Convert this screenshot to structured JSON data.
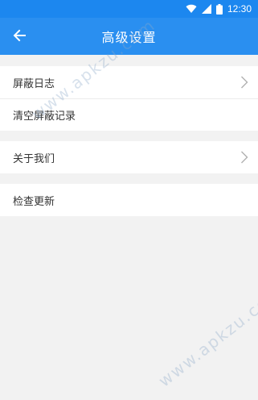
{
  "status_bar": {
    "time": "12:30"
  },
  "app_bar": {
    "title": "高级设置"
  },
  "groups": [
    {
      "items": [
        {
          "label": "屏蔽日志",
          "has_chevron": true
        },
        {
          "label": "清空屏蔽记录",
          "has_chevron": false
        }
      ]
    },
    {
      "items": [
        {
          "label": "关于我们",
          "has_chevron": true
        }
      ]
    },
    {
      "items": [
        {
          "label": "检查更新",
          "has_chevron": false
        }
      ]
    }
  ],
  "watermark": {
    "text": "www.apkzu.com"
  },
  "colors": {
    "primary": "#2a8ff0",
    "status_bar": "#1c87ef",
    "background": "#f2f2f2",
    "text": "#333333"
  },
  "icons": {
    "back": "arrow-left-icon",
    "chevron": "chevron-right-icon",
    "wifi": "wifi-icon",
    "signal": "cell-signal-icon",
    "battery": "battery-icon"
  }
}
